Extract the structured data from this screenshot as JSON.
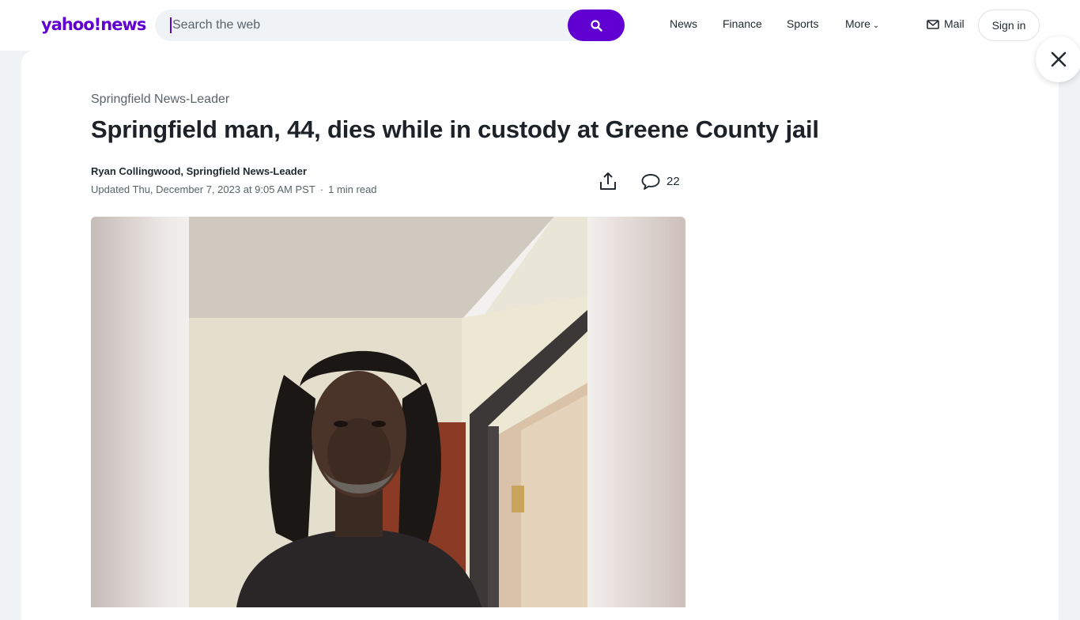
{
  "header": {
    "logo": "yahoo!news",
    "search_placeholder": "Search the web",
    "nav": [
      "News",
      "Finance",
      "Sports",
      "More"
    ],
    "mail_label": "Mail",
    "signin_label": "Sign in"
  },
  "article": {
    "provider": "Springfield News-Leader",
    "headline": "Springfield man, 44, dies while in custody at Greene County jail",
    "byline": "Ryan Collingwood, Springfield News-Leader",
    "updated": "Updated Thu, December 7, 2023 at 9:05 AM PST",
    "read_time": "1 min read",
    "comment_count": "22"
  },
  "colors": {
    "brand": "#6001d2",
    "text": "#232a31",
    "muted": "#5b636a",
    "page_bg": "#f0f3f5"
  },
  "icons": [
    "search-icon",
    "chevron-down-icon",
    "mail-icon",
    "close-icon",
    "share-icon",
    "comment-icon"
  ]
}
